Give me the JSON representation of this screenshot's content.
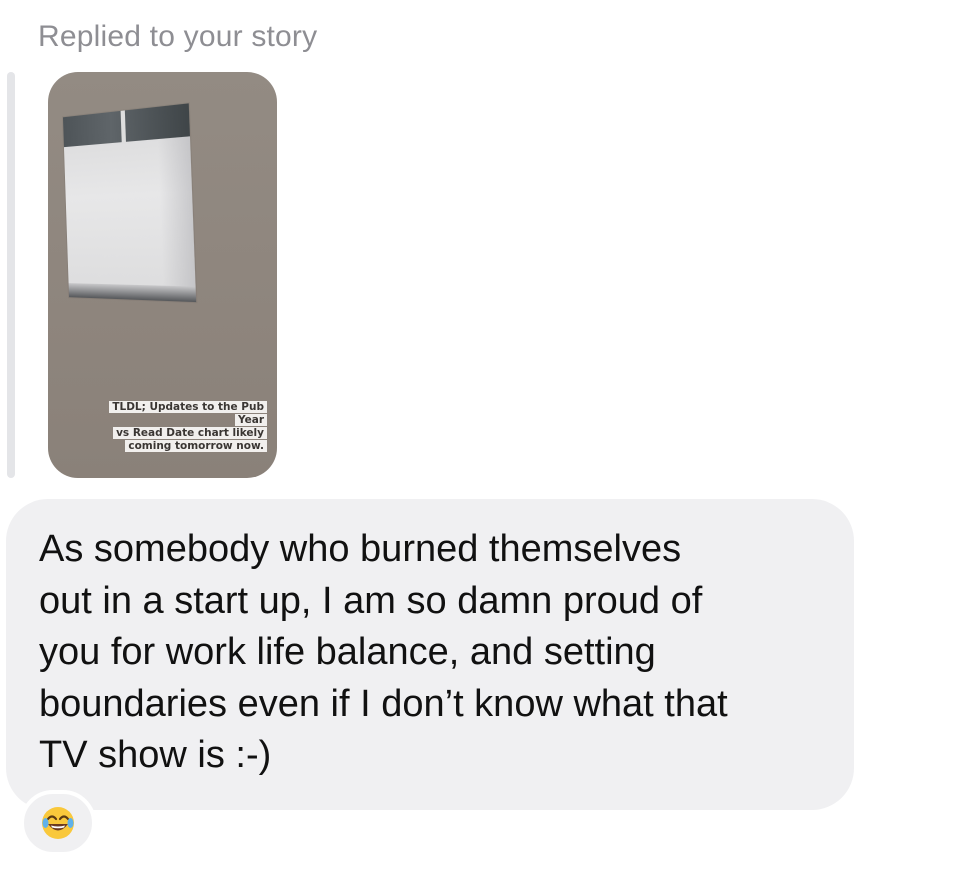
{
  "reply": {
    "header": "Replied to your story"
  },
  "story": {
    "caption_lines": [
      "TLDL; Updates to the Pub Year",
      "vs Read Date chart likely",
      "coming tomorrow now."
    ]
  },
  "message": {
    "text": "As somebody who burned themselves\nout in a start up, I am so damn proud of\nyou for work life balance, and setting\nboundaries even if I don’t know what that\nTV show is :-)"
  },
  "reaction": {
    "icon": "face-with-tears-of-joy-icon"
  }
}
